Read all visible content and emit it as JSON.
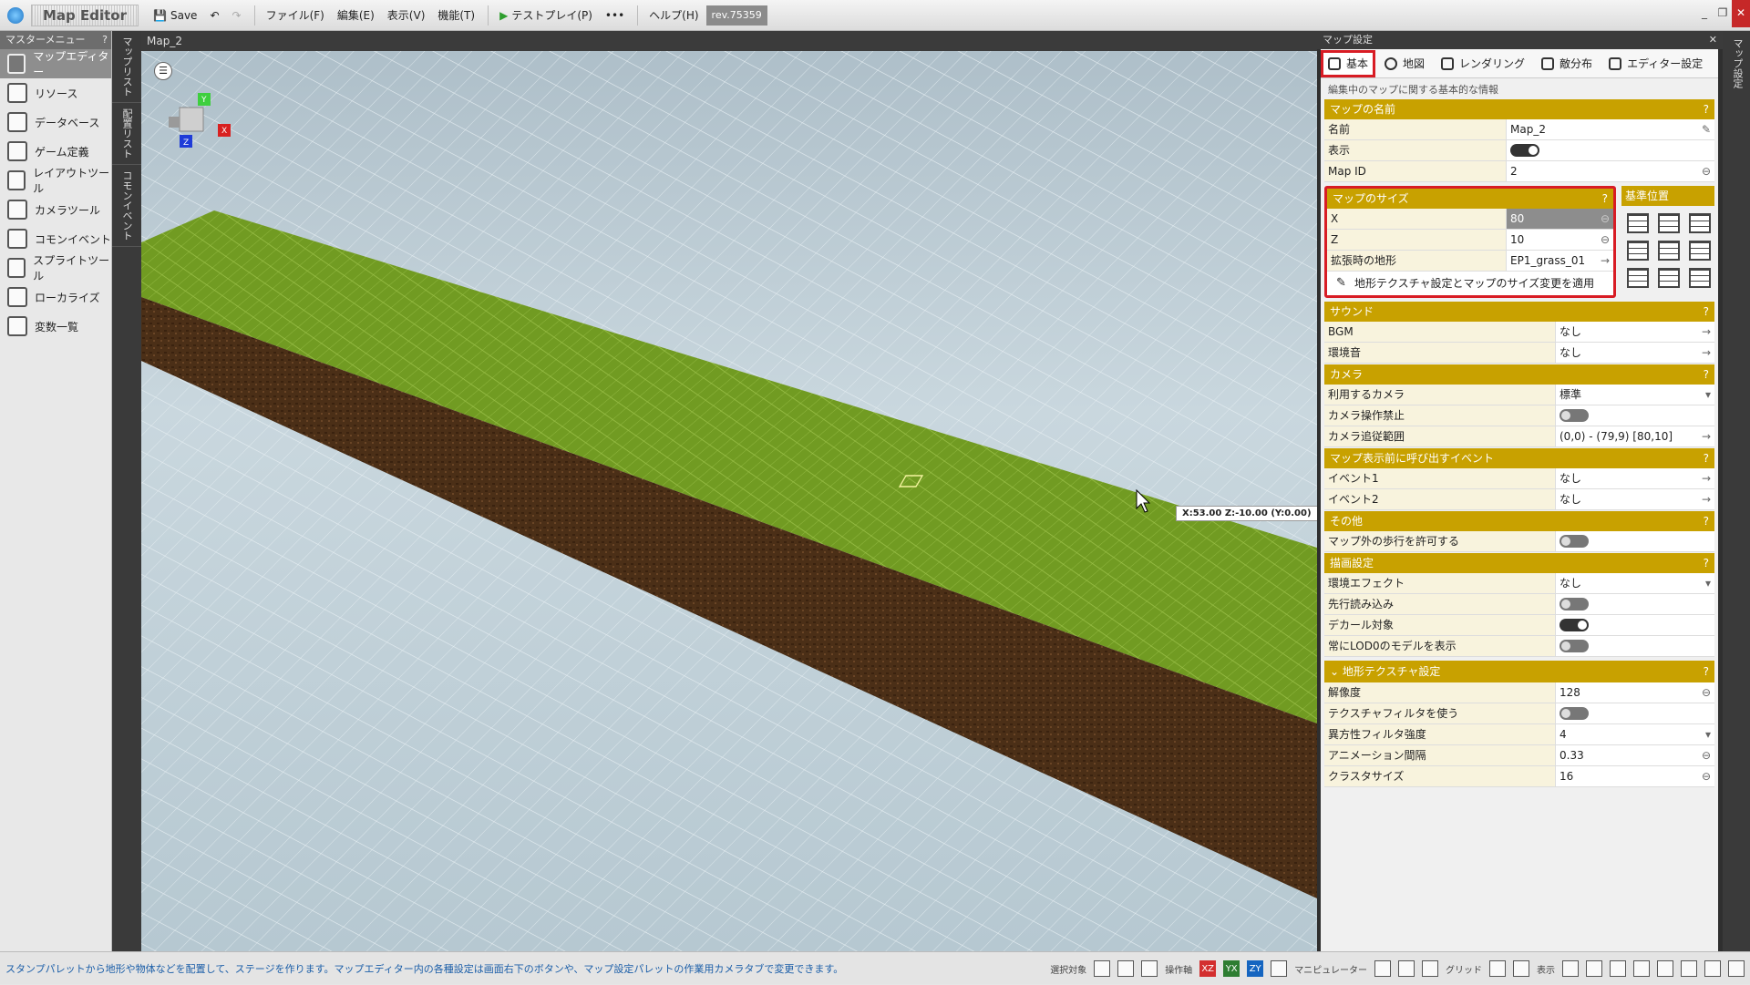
{
  "app": {
    "title": "Map Editor",
    "rev": "rev.75359"
  },
  "toolbar": {
    "save": "Save",
    "menus": [
      "ファイル(F)",
      "編集(E)",
      "表示(V)",
      "機能(T)"
    ],
    "testplay": "テストプレイ(P)",
    "more": "•••",
    "help": "ヘルプ(H)"
  },
  "leftmenu": {
    "header": "マスターメニュー",
    "items": [
      "マップエディター",
      "リソース",
      "データベース",
      "ゲーム定義",
      "レイアウトツール",
      "カメラツール",
      "コモンイベント",
      "スプライトツール",
      "ローカライズ",
      "変数一覧"
    ]
  },
  "vtabs": [
    "マップリスト",
    "配置リスト",
    "コモンイベント"
  ],
  "viewport": {
    "title": "Map_2",
    "coord": "X:53.00 Z:-10.00 (Y:0.00)",
    "menu_glyph": "☰"
  },
  "panel": {
    "title": "マップ設定",
    "tabs": [
      "基本",
      "地図",
      "レンダリング",
      "敵分布",
      "エディター設定"
    ],
    "desc": "編集中のマップに関する基本的な情報",
    "name_section": "マップの名前",
    "name_rows": [
      {
        "k": "名前",
        "v": "Map_2"
      },
      {
        "k": "表示",
        "v": ""
      },
      {
        "k": "Map ID",
        "v": "2"
      }
    ],
    "size_section": "マップのサイズ",
    "size_rows": [
      {
        "k": "X",
        "v": "80"
      },
      {
        "k": "Z",
        "v": "10"
      },
      {
        "k": "拡張時の地形",
        "v": "EP1_grass_01"
      }
    ],
    "apply": "地形テクスチャ設定とマップのサイズ変更を適用",
    "anchor": "基準位置",
    "sound_section": "サウンド",
    "sound_rows": [
      {
        "k": "BGM",
        "v": "なし"
      },
      {
        "k": "環境音",
        "v": "なし"
      }
    ],
    "camera_section": "カメラ",
    "camera_rows": [
      {
        "k": "利用するカメラ",
        "v": "標準"
      },
      {
        "k": "カメラ操作禁止",
        "v": ""
      },
      {
        "k": "カメラ追従範囲",
        "v": "(0,0) - (79,9) [80,10]"
      }
    ],
    "event_section": "マップ表示前に呼び出すイベント",
    "event_rows": [
      {
        "k": "イベント1",
        "v": "なし"
      },
      {
        "k": "イベント2",
        "v": "なし"
      }
    ],
    "other_section": "その他",
    "other_rows": [
      {
        "k": "マップ外の歩行を許可する",
        "v": ""
      }
    ],
    "draw_section": "描画設定",
    "draw_rows": [
      {
        "k": "環境エフェクト",
        "v": "なし"
      },
      {
        "k": "先行読み込み",
        "v": ""
      },
      {
        "k": "デカール対象",
        "v": ""
      },
      {
        "k": "常にLOD0のモデルを表示",
        "v": ""
      }
    ],
    "tex_section": "地形テクスチャ設定",
    "tex_rows": [
      {
        "k": "解像度",
        "v": "128"
      },
      {
        "k": "テクスチャフィルタを使う",
        "v": ""
      },
      {
        "k": "異方性フィルタ強度",
        "v": "4"
      },
      {
        "k": "アニメーション間隔",
        "v": "0.33"
      },
      {
        "k": "クラスタサイズ",
        "v": "16"
      }
    ],
    "help": "?"
  },
  "rvtab": "マップ設定",
  "statusbar": {
    "message": "スタンプパレットから地形や物体などを配置して、ステージを作ります。マップエディター内の各種設定は画面右下のボタンや、マップ設定パレットの作業用カメラタブで変更できます。",
    "labels": [
      "選択対象",
      "操作軸",
      "マニピュレーター",
      "グリッド",
      "表示"
    ],
    "axes": [
      "XZ",
      "YX",
      "ZY"
    ]
  },
  "colors": {
    "accent": "#c8a100",
    "highlight": "#d81c24",
    "grass": "#6f9a1e",
    "dirt": "#4a2e18"
  }
}
